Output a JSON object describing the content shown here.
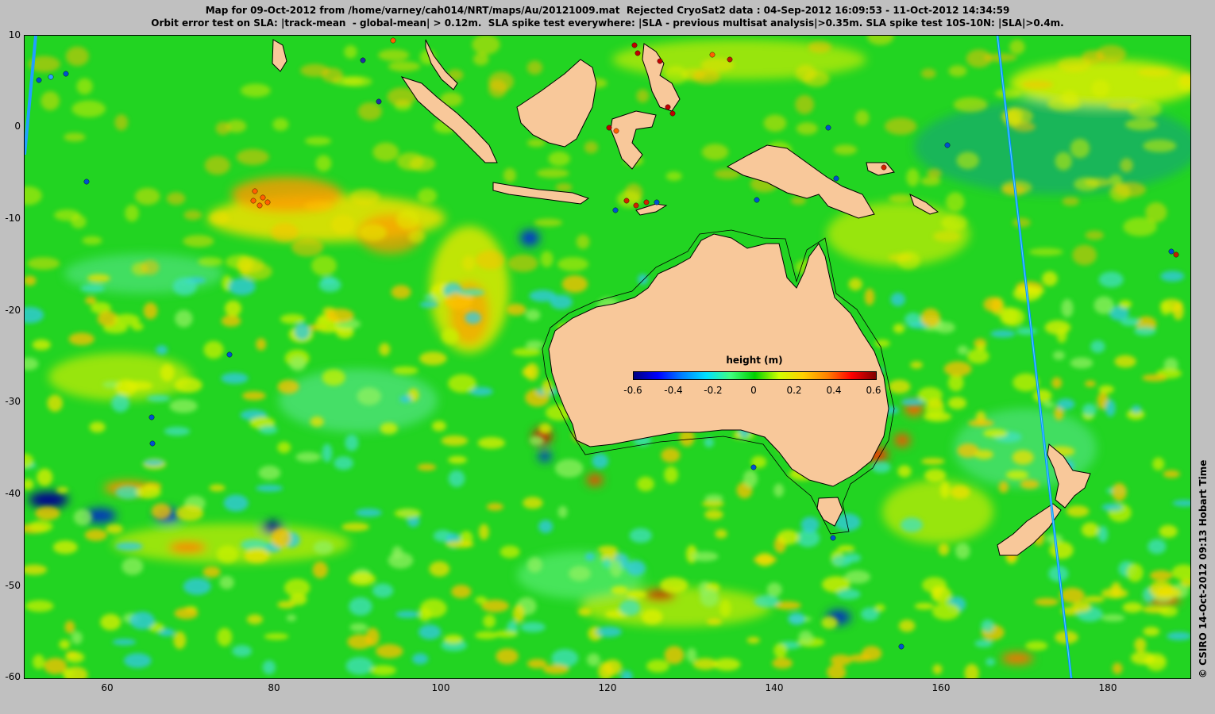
{
  "title": {
    "line1": "Map for 09-Oct-2012 from /home/varney/cah014/NRT/maps/Au/20121009.mat  Rejected CryoSat2 data : 04-Sep-2012 16:09:53 - 11-Oct-2012 14:34:59",
    "line2": "Orbit error test on SLA: |track-mean  - global-mean| > 0.12m.  SLA spike test everywhere: |SLA - previous multisat analysis|>0.35m. SLA spike test 10S-10N: |SLA|>0.4m."
  },
  "credit": "© CSIRO 14-Oct-2012 09:13 Hobart Time",
  "colorbar": {
    "title": "height (m)",
    "ticks": [
      "-0.6",
      "-0.4",
      "-0.2",
      "0",
      "0.2",
      "0.4",
      "0.6"
    ],
    "colors": [
      "#00007f",
      "#0000ff",
      "#0080ff",
      "#00e0ff",
      "#40ff80",
      "#00d000",
      "#d0ff00",
      "#ffd000",
      "#ff8000",
      "#ff0000",
      "#7f0000"
    ]
  },
  "axes": {
    "x_ticks": [
      "60",
      "80",
      "100",
      "120",
      "140",
      "160",
      "180"
    ],
    "y_ticks": [
      "10",
      "0",
      "-10",
      "-20",
      "-30",
      "-40",
      "-50",
      "-60"
    ]
  },
  "map": {
    "lon_range": [
      50,
      190
    ],
    "lat_range": [
      -60,
      10
    ],
    "ocean_color": "#22d422",
    "land_color": "#f8c89a"
  }
}
